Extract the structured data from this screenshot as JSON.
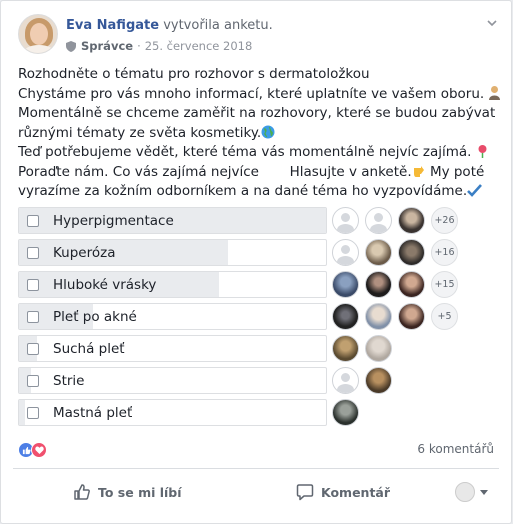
{
  "post": {
    "author": "Eva Nafigate",
    "action": "vytvořila anketu.",
    "role": "Správce",
    "separator": "·",
    "date": "25. července 2018"
  },
  "text": {
    "line1": "Rozhodněte o tématu pro rozhovor s dermatoložkou",
    "line2": "Chystáme pro vás mnoho informací, které uplatníte ve vašem oboru.",
    "line3": "Momentálně se chceme zaměřit na rozhovory, které se budou zabývat",
    "line4": "různými tématy ze světa kosmetiky.",
    "line5": "Teď potřebujeme vědět, které téma vás momentálně nejvíc zajímá.",
    "line6a": "Poraďte nám. Co vás zajímá nejvíce",
    "line6b": "Hlasujte v anketě.",
    "line6c": "My poté",
    "line7": "vyrazíme za kožním odborníkem a na dané téma ho vyzpovídáme."
  },
  "poll": {
    "options": [
      {
        "label": "Hyperpigmentace",
        "fill": 1.0,
        "more": "+26"
      },
      {
        "label": "Kuperóza",
        "fill": 0.68,
        "more": "+16"
      },
      {
        "label": "Hluboké vrásky",
        "fill": 0.65,
        "more": "+15"
      },
      {
        "label": "Pleť po akné",
        "fill": 0.24,
        "more": "+5"
      },
      {
        "label": "Suchá pleť",
        "fill": 0.06,
        "more": ""
      },
      {
        "label": "Strie",
        "fill": 0.04,
        "more": ""
      },
      {
        "label": "Mastná pleť",
        "fill": 0.02,
        "more": ""
      }
    ]
  },
  "stats": {
    "comments": "6 komentářů"
  },
  "actions": {
    "like": "To se mi líbí",
    "comment": "Komentář"
  },
  "colors": {
    "link": "#365899",
    "like_blue": "#4d7fe6",
    "love_red": "#f0506e",
    "bar_fill": "#e9ebee"
  },
  "icons": [
    "shield-icon",
    "chevron-down-icon",
    "globe-icon",
    "rose-icon",
    "pointing-hand-icon",
    "check-mark-icon",
    "like-reaction-icon",
    "love-reaction-icon",
    "thumbs-up-icon",
    "comment-icon"
  ]
}
